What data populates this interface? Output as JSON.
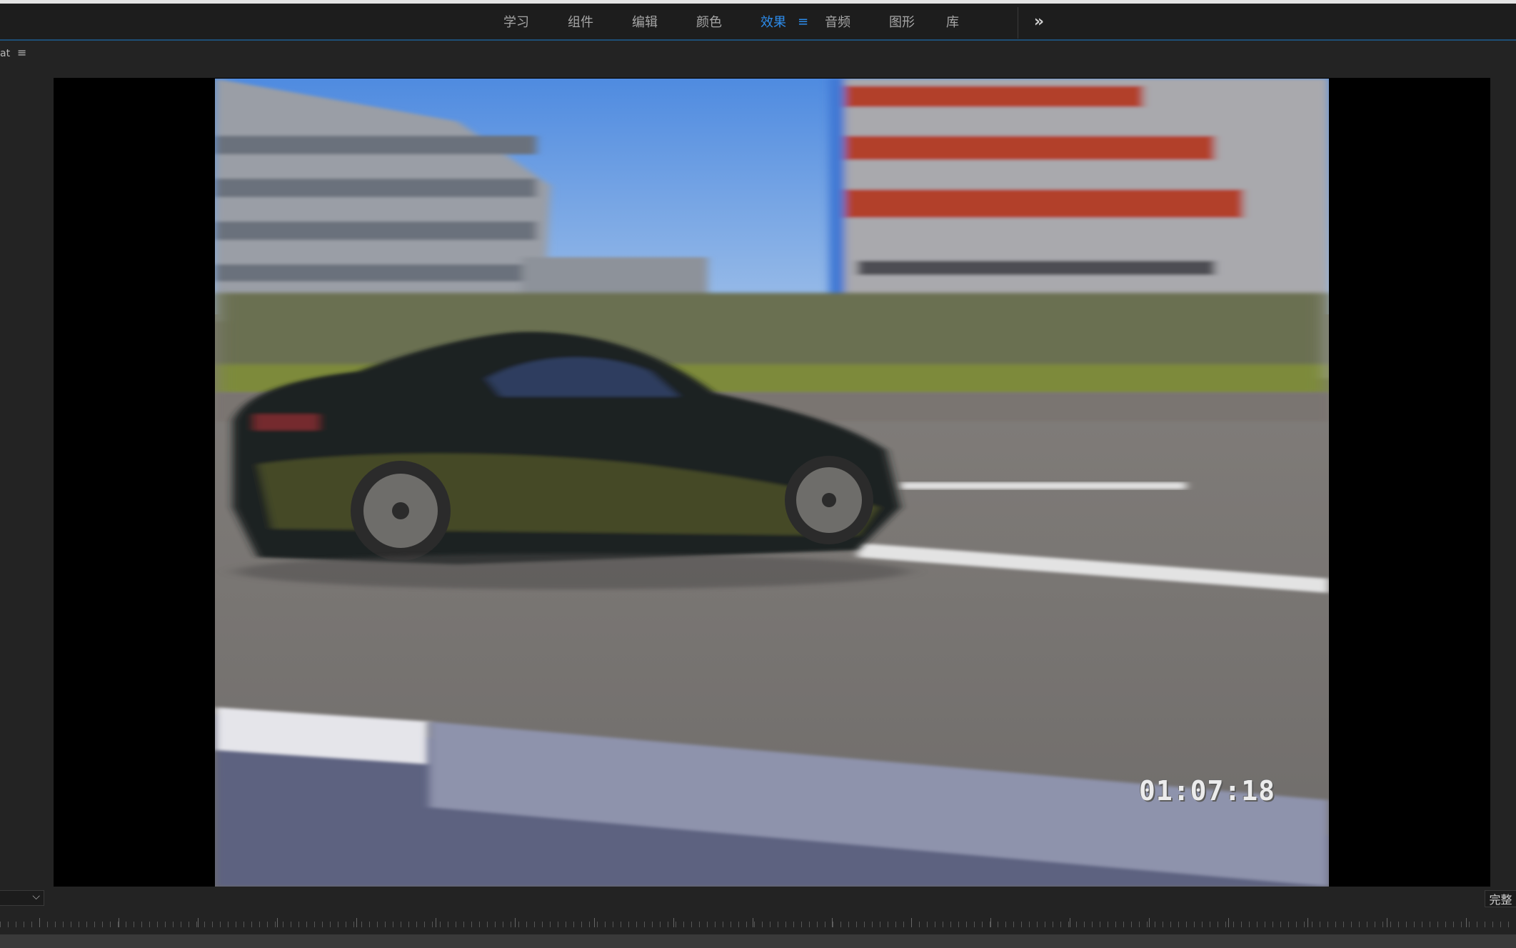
{
  "workspace": {
    "tabs": [
      {
        "label": "学习",
        "active": false
      },
      {
        "label": "组件",
        "active": false
      },
      {
        "label": "编辑",
        "active": false
      },
      {
        "label": "颜色",
        "active": false
      },
      {
        "label": "效果",
        "active": true
      },
      {
        "label": "音频",
        "active": false
      },
      {
        "label": "图形",
        "active": false
      },
      {
        "label": "库",
        "active": false
      }
    ],
    "active_tab_menu_icon": "≡",
    "overflow_icon": "»",
    "accent_color": "#2d8ceb"
  },
  "panel": {
    "name": "at",
    "menu_icon": "≡"
  },
  "viewer": {
    "timecode": "01:07:18"
  },
  "controls": {
    "zoom_value": "",
    "zoom_chevron": "⌵",
    "quality": "完整"
  }
}
